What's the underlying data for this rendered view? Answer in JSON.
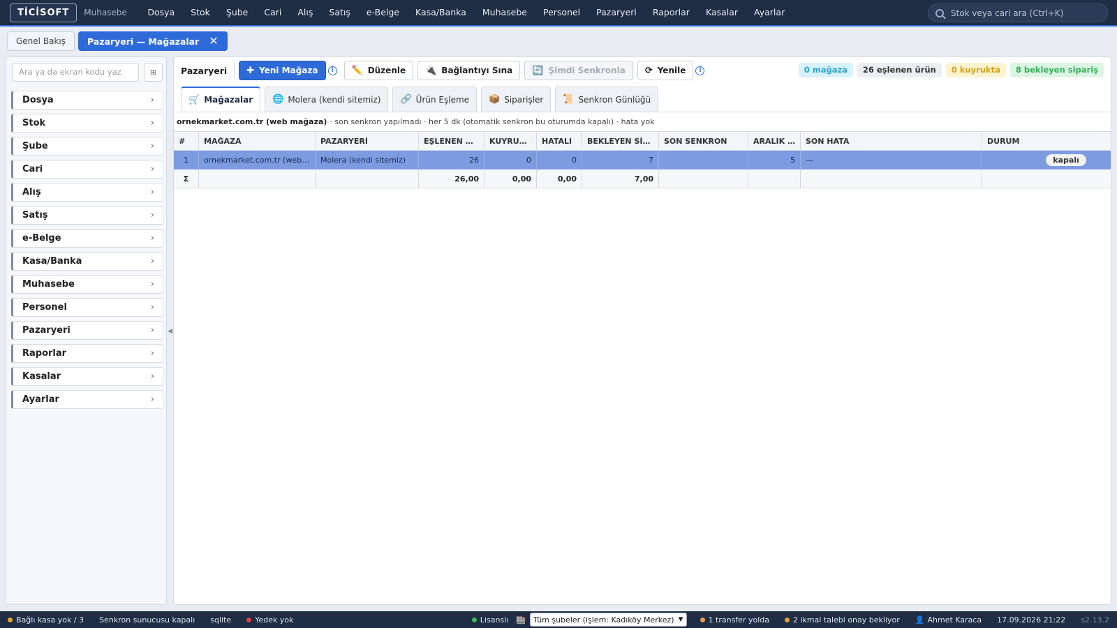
{
  "app": {
    "logo": "TİCİSOFT",
    "subtitle": "Muhasebe",
    "menu": [
      "Dosya",
      "Stok",
      "Şube",
      "Cari",
      "Alış",
      "Satış",
      "e-Belge",
      "Kasa/Banka",
      "Muhasebe",
      "Personel",
      "Pazaryeri",
      "Raporlar",
      "Kasalar",
      "Ayarlar"
    ],
    "search_placeholder": "Stok veya cari ara (Ctrl+K)"
  },
  "tabs": {
    "overview": "Genel Bakış",
    "active": "Pazaryeri — Mağazalar",
    "close": "✕"
  },
  "sidebar": {
    "search_placeholder": "Ara ya da ekran kodu yaz",
    "grid_btn": "⊞",
    "items": [
      "Dosya",
      "Stok",
      "Şube",
      "Cari",
      "Alış",
      "Satış",
      "e-Belge",
      "Kasa/Banka",
      "Muhasebe",
      "Personel",
      "Pazaryeri",
      "Raporlar",
      "Kasalar",
      "Ayarlar"
    ],
    "chevron": "›",
    "collapse": "◀"
  },
  "toolbar": {
    "title": "Pazaryeri",
    "new_store": "Yeni Mağaza",
    "edit": "Düzenle",
    "test": "Bağlantıyı Sına",
    "sync_now": "Şimdi Senkronla",
    "refresh": "Yenile",
    "info": "i",
    "badges": [
      {
        "text": "0 mağaza",
        "bg": "#d8f1fa",
        "fg": "#26a6d1"
      },
      {
        "text": "26 eşlenen ürün",
        "bg": "#eceef2",
        "fg": "#333333"
      },
      {
        "text": "0 kuyrukta",
        "bg": "#fdf3d0",
        "fg": "#d4a21a"
      },
      {
        "text": "8 bekleyen sipariş",
        "bg": "#dcf5e3",
        "fg": "#35b05a"
      }
    ]
  },
  "subtabs": [
    "Mağazalar",
    "Molera (kendi sitemiz)",
    "Ürün Eşleme",
    "Siparişler",
    "Senkron Günlüğü"
  ],
  "infoline": {
    "store": "ornekmarket.com.tr (web mağaza)",
    "detail": "· son senkron yapılmadı · her 5 dk (otomatik senkron bu oturumda kapalı) · hata yok"
  },
  "table": {
    "headers": [
      "#",
      "MAĞAZA",
      "PAZARYERİ",
      "EŞLENEN ÜRÜN",
      "KUYRUKTA",
      "HATALI",
      "BEKLEYEN SİPARİŞ",
      "SON SENKRON",
      "ARALIK (DK)",
      "SON HATA",
      "DURUM"
    ],
    "row": {
      "no": "1",
      "store": "ornekmarket.com.tr (web mağaza)",
      "market": "Molera (kendi sitemiz)",
      "matched": "26",
      "queue": "0",
      "errors": "0",
      "pending": "7",
      "last_sync": "",
      "interval": "5",
      "last_error": "—",
      "status": "kapalı"
    },
    "sum": {
      "symbol": "Σ",
      "matched": "26,00",
      "queue": "0,00",
      "errors": "0,00",
      "pending": "7,00"
    }
  },
  "statusbar": {
    "kasa": "Bağlı kasa yok / 3",
    "sync_server": "Senkron sunucusu kapalı",
    "db": "sqlite",
    "backup": "Yedek yok",
    "license": "Lisanslı",
    "branch": "Tüm şubeler (işlem: Kadıköy Merkez)",
    "transfer": "1 transfer yolda",
    "ikmal": "2 ikmal talebi onay bekliyor",
    "user": "Ahmet Karaca",
    "datetime": "17.09.2026 21:22",
    "version": "s2.13.2"
  },
  "colors": {
    "accent": "#2f6bd8",
    "topbar": "#1f2d45",
    "selected_row": "#7c9be1"
  }
}
